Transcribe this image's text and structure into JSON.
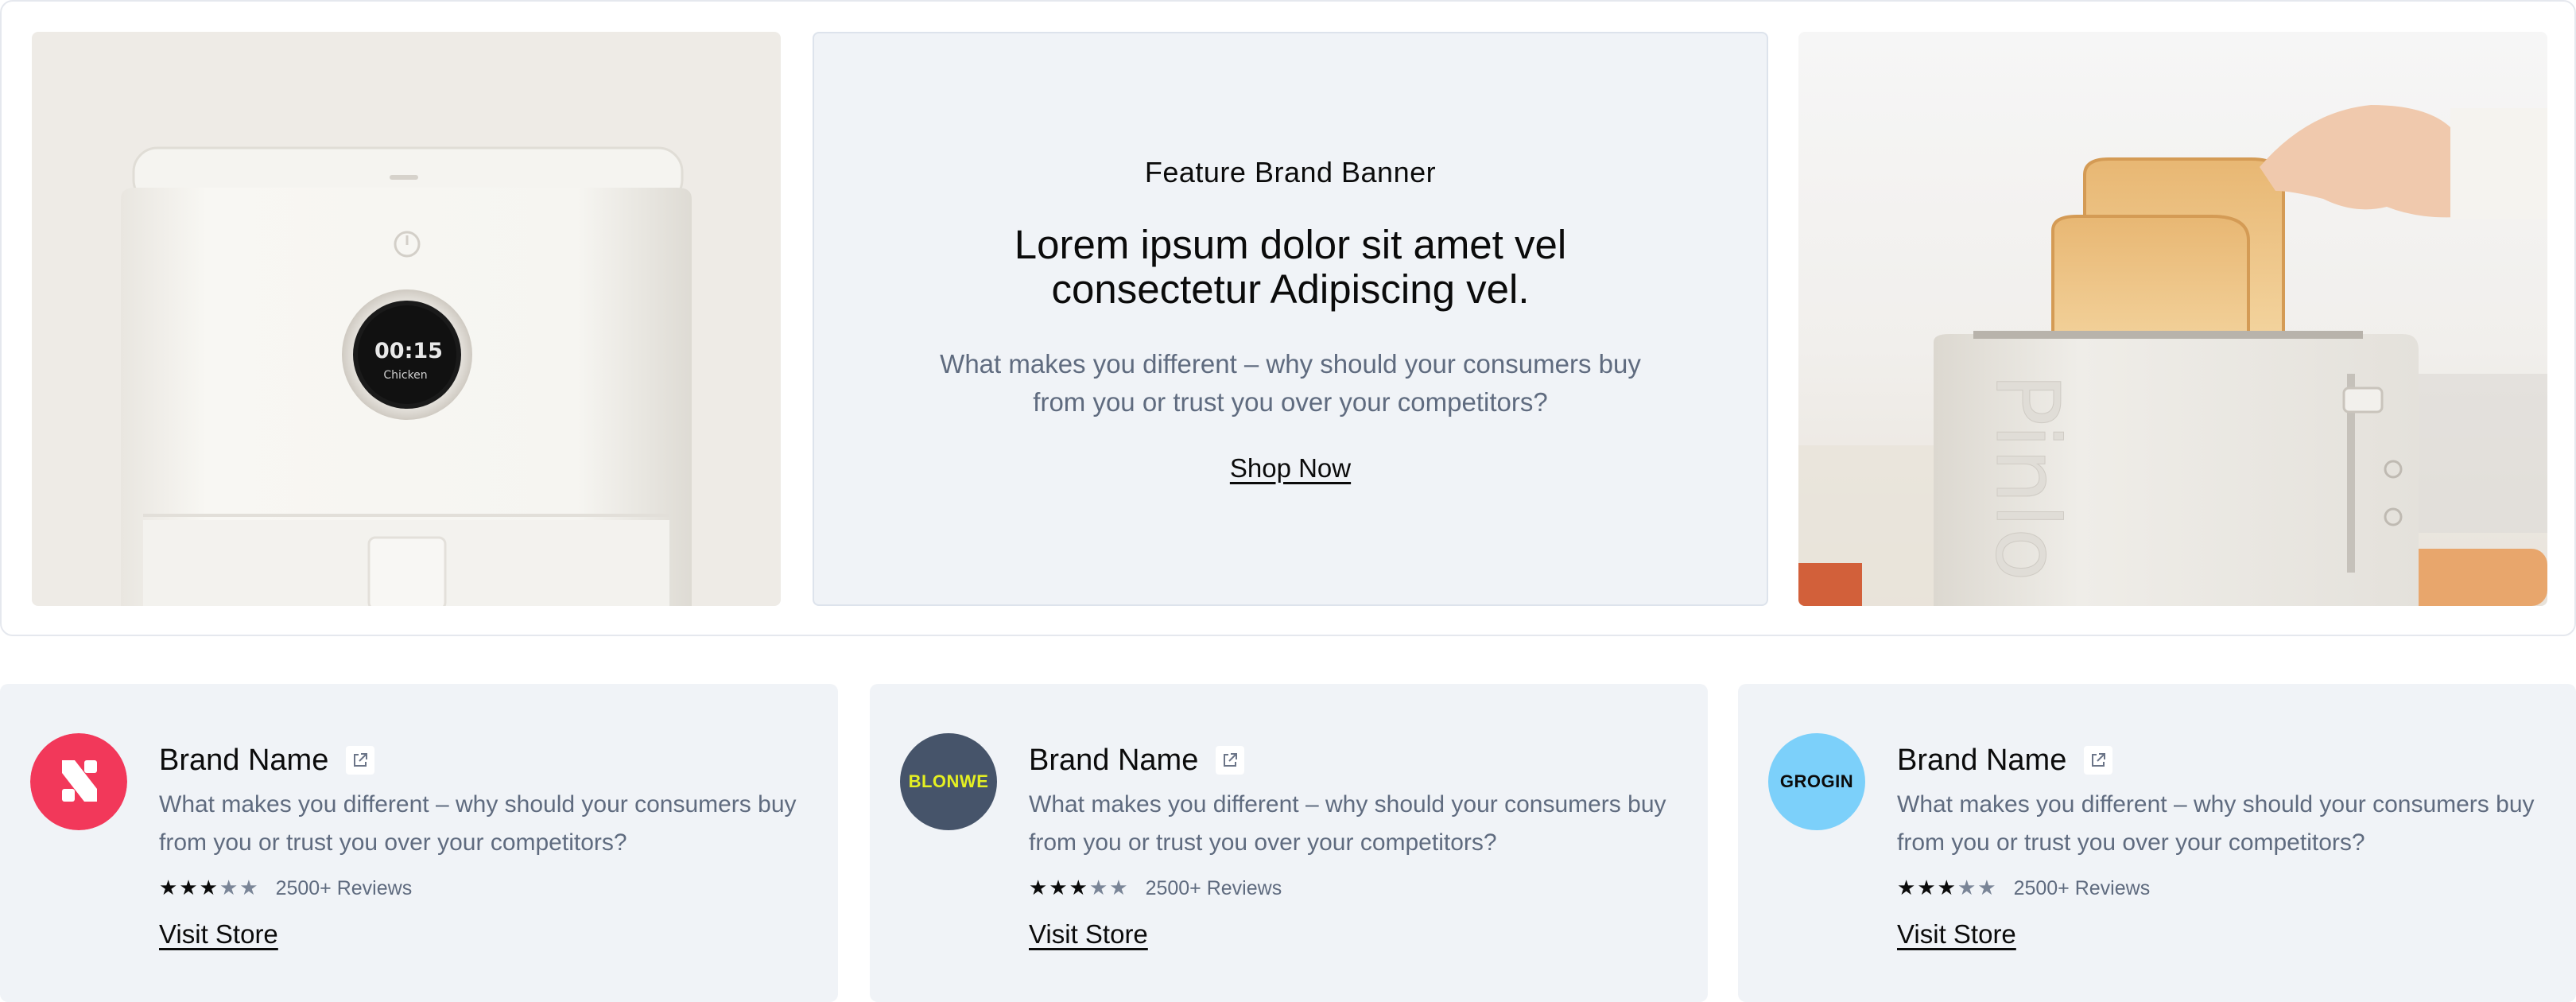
{
  "banner": {
    "eyebrow": "Feature Brand Banner",
    "headline": "Lorem ipsum dolor sit amet vel consectetur Adipiscing vel.",
    "description": "What makes you different – why should your consumers buy from you or trust you over your competitors?",
    "cta_label": "Shop Now",
    "left_image": {
      "display_time": "00:15",
      "display_mode": "Chicken"
    },
    "right_image": {
      "toaster_brand": "Pinlo"
    },
    "colors": {
      "panel_bg": "#f0f3f7",
      "text": "#0b0b0b",
      "muted": "#5f6b7f"
    }
  },
  "brands": [
    {
      "name": "Brand Name",
      "description": "What makes you different – why should your consumers buy from you or trust you over your competitors?",
      "rating": 3,
      "rating_max": 5,
      "reviews": "2500+ Reviews",
      "cta_label": "Visit Store",
      "logo": {
        "icon": "s-mark-logo",
        "bg": "#f2385a",
        "fg": "#ffffff"
      }
    },
    {
      "name": "Brand Name",
      "description": "What makes you different – why should your consumers buy from you or trust you over your competitors?",
      "rating": 3,
      "rating_max": 5,
      "reviews": "2500+ Reviews",
      "cta_label": "Visit Store",
      "logo": {
        "text": "BLONWE",
        "bg": "#46546a",
        "fg": "#e4ef22"
      }
    },
    {
      "name": "Brand Name",
      "description": "What makes you different – why should your consumers buy from you or trust you over your competitors?",
      "rating": 3,
      "rating_max": 5,
      "reviews": "2500+ Reviews",
      "cta_label": "Visit Store",
      "logo": {
        "text": "GROGIN",
        "bg": "#7cd0fa",
        "fg": "#0b0b0b"
      }
    }
  ]
}
